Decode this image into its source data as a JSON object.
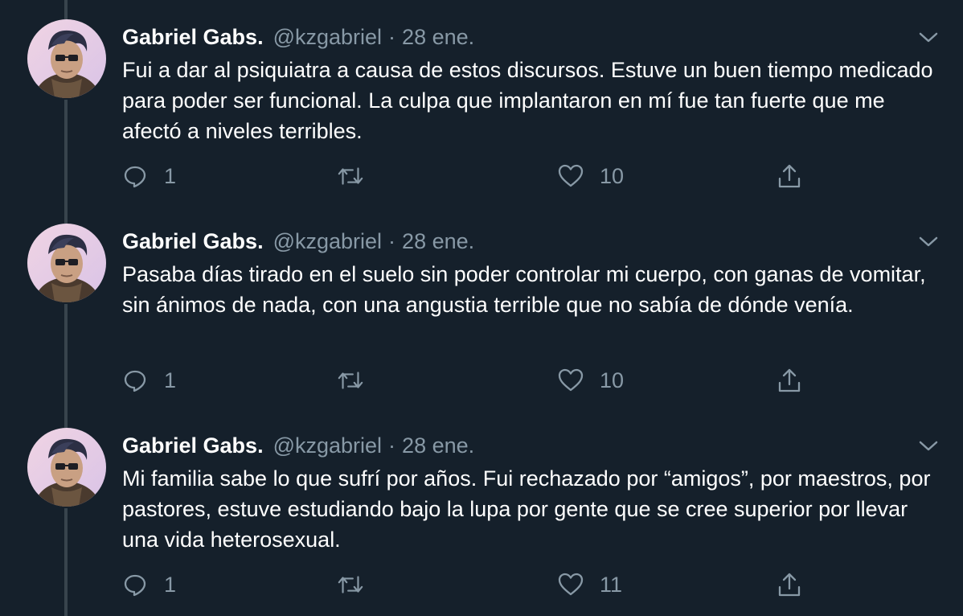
{
  "colors": {
    "background": "#15202b",
    "thread_line": "#38444d",
    "text_primary": "#ffffff",
    "text_secondary": "#8899a6"
  },
  "tweets": [
    {
      "author_name": "Gabriel Gabs.",
      "author_handle": "@kzgabriel",
      "separator": "·",
      "date": "28 ene.",
      "text": "Fui a dar al psiquiatra a causa de estos discursos. Estuve un buen tiempo medicado para poder ser funcional. La culpa que implantaron en mí fue tan fuerte que me afectó a niveles terribles.",
      "replies": "1",
      "retweets": "",
      "likes": "10"
    },
    {
      "author_name": "Gabriel Gabs.",
      "author_handle": "@kzgabriel",
      "separator": "·",
      "date": "28 ene.",
      "text": "Pasaba días tirado en el suelo sin poder controlar mi cuerpo, con ganas de vomitar, sin ánimos de nada, con una angustia terrible que no sabía de dónde venía.",
      "replies": "1",
      "retweets": "",
      "likes": "10"
    },
    {
      "author_name": "Gabriel Gabs.",
      "author_handle": "@kzgabriel",
      "separator": "·",
      "date": "28 ene.",
      "text": "Mi familia sabe lo que sufrí por años. Fui rechazado por “amigos”, por maestros, por pastores, estuve estudiando bajo la lupa por gente que se cree superior por llevar una vida heterosexual.",
      "replies": "1",
      "retweets": "",
      "likes": "11"
    }
  ],
  "icons": {
    "reply": "reply-icon",
    "retweet": "retweet-icon",
    "like": "heart-icon",
    "share": "share-icon",
    "more": "chevron-down-icon",
    "avatar": "avatar"
  }
}
